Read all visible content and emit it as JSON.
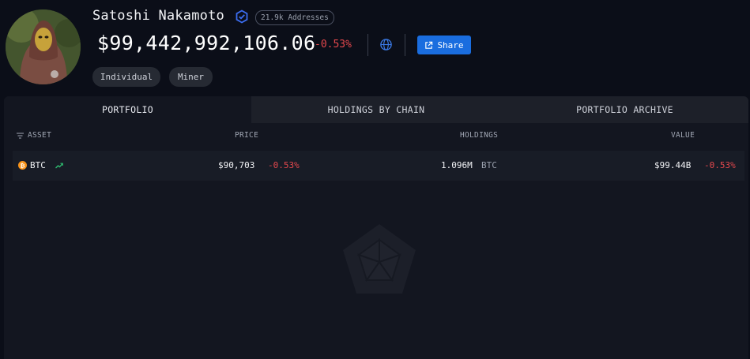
{
  "profile": {
    "name": "Satoshi Nakamoto",
    "addresses_badge": "21.9k Addresses",
    "total_value": "$99,442,992,106.06",
    "total_change": "-0.53%",
    "share_label": "Share",
    "tags": [
      "Individual",
      "Miner"
    ]
  },
  "tabs": [
    {
      "label": "PORTFOLIO",
      "active": true
    },
    {
      "label": "HOLDINGS BY CHAIN",
      "active": false
    },
    {
      "label": "PORTFOLIO ARCHIVE",
      "active": false
    }
  ],
  "table": {
    "headers": {
      "asset": "ASSET",
      "price": "PRICE",
      "holdings": "HOLDINGS",
      "value": "VALUE"
    },
    "rows": [
      {
        "asset": "BTC",
        "price": "$90,703",
        "price_change": "-0.53%",
        "holdings": "1.096M",
        "holdings_unit": "BTC",
        "value": "$99.44B",
        "value_change": "-0.53%"
      }
    ]
  },
  "colors": {
    "background": "#0b0e18",
    "panel": "#131620",
    "negative": "#e5484d",
    "accent": "#1a6ddf",
    "btc": "#f7931a",
    "trend": "#2fbf71"
  },
  "icons": [
    "verified-badge-icon",
    "globe-icon",
    "share-icon",
    "sort-icon",
    "btc-coin-icon",
    "trend-up-icon",
    "arkham-logo-icon"
  ]
}
